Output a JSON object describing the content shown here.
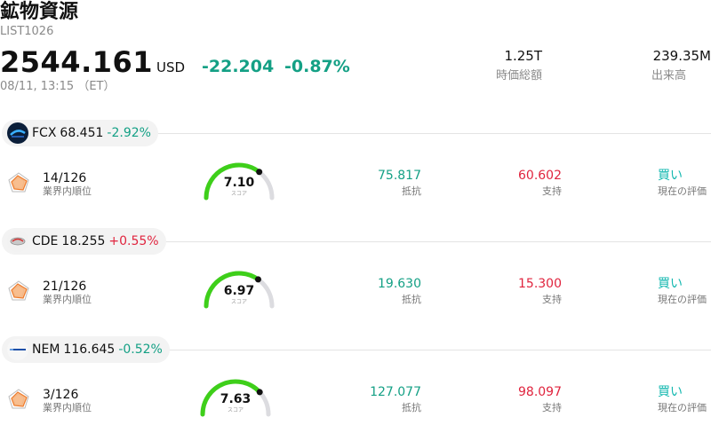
{
  "header": {
    "title": "鉱物資源",
    "code": "LIST1026",
    "price": "2544.161",
    "currency": "USD",
    "change": "-22.204",
    "change_pct": "-0.87%",
    "timestamp": "08/11, 13:15 （ET）",
    "market_cap": {
      "value": "1.25T",
      "label": "時価総額"
    },
    "volume": {
      "value": "239.35M",
      "label": "出来高"
    }
  },
  "colors": {
    "down": "#14a085",
    "up": "#e0243e",
    "rating": "#14b8b0",
    "gauge_fill": "#3ecf1a",
    "gauge_track": "#dcdce0"
  },
  "stocks": [
    {
      "symbol": "FCX",
      "price": "68.451",
      "change": "-2.92%",
      "direction": "down",
      "logo_icon": "fcx-logo-icon",
      "rank": "14/126",
      "rank_label": "業界内順位",
      "radar_icon": "radar-chart-icon",
      "score": "7.10",
      "score_value": 7.1,
      "score_label": "スコア",
      "resistance": "75.817",
      "resistance_label": "抵抗",
      "support": "60.602",
      "support_label": "支持",
      "rating": "買い",
      "rating_label": "現在の評価"
    },
    {
      "symbol": "CDE",
      "price": "18.255",
      "change": "+0.55%",
      "direction": "up",
      "logo_icon": "cde-logo-icon",
      "rank": "21/126",
      "rank_label": "業界内順位",
      "radar_icon": "radar-chart-icon",
      "score": "6.97",
      "score_value": 6.97,
      "score_label": "スコア",
      "resistance": "19.630",
      "resistance_label": "抵抗",
      "support": "15.300",
      "support_label": "支持",
      "rating": "買い",
      "rating_label": "現在の評価"
    },
    {
      "symbol": "NEM",
      "price": "116.645",
      "change": "-0.52%",
      "direction": "down",
      "logo_icon": "nem-logo-icon",
      "rank": "3/126",
      "rank_label": "業界内順位",
      "radar_icon": "radar-chart-icon",
      "score": "7.63",
      "score_value": 7.63,
      "score_label": "スコア",
      "resistance": "127.077",
      "resistance_label": "抵抗",
      "support": "98.097",
      "support_label": "支持",
      "rating": "買い",
      "rating_label": "現在の評価"
    }
  ]
}
